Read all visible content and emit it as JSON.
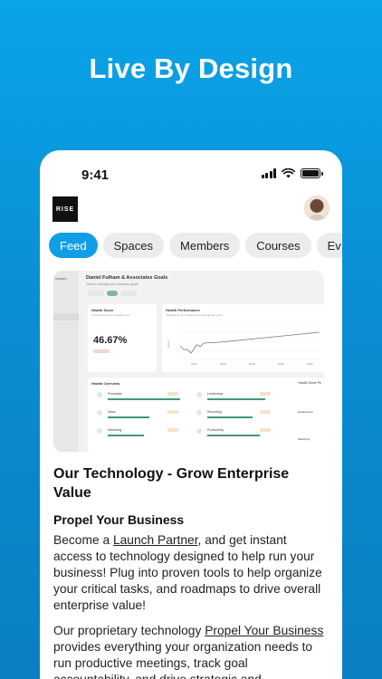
{
  "headline": "Live By Design",
  "status": {
    "time": "9:41"
  },
  "app": {
    "logo_text": "RISE",
    "tabs": [
      "Feed",
      "Spaces",
      "Members",
      "Courses",
      "Ev"
    ]
  },
  "hero": {
    "title": "Daniel Fulham & Associates Goals",
    "subtitle": "Track & manage your business goals",
    "sidebar_label": "sociates",
    "health_score": {
      "title": "Health Score",
      "subtitle": "Company's current health score",
      "value": "46.67%"
    },
    "health_performance": {
      "title": "Health Performance",
      "subtitle": "Changes in your health score through the years",
      "x_ticks": [
        "2015",
        "2020",
        "2025",
        "2030",
        "2035"
      ],
      "y_label": "Score"
    },
    "overview": {
      "title": "Health Overview",
      "right_label": "Health Score Pe",
      "items": [
        "Financials",
        "Leadership",
        "Sales",
        "Recruiting",
        "Marketing",
        "Productivity"
      ],
      "side_labels": [
        "Relationship",
        "Marketing"
      ]
    }
  },
  "post": {
    "title": "Our Technology - Grow Enterprise Value",
    "subheading": "Propel Your Business",
    "para1_before": "Become a ",
    "para1_link": "Launch Partner",
    "para1_after": ", and get instant access to technology designed to help run your business! Plug into proven tools to help organize your critical tasks, and roadmaps to drive overall enterprise value!",
    "para2_before": "Our proprietary technology ",
    "para2_link": "Propel Your Business",
    "para2_after": " provides everything your organization needs to run productive meetings, track goal accountability, and drive strategic and operational"
  }
}
